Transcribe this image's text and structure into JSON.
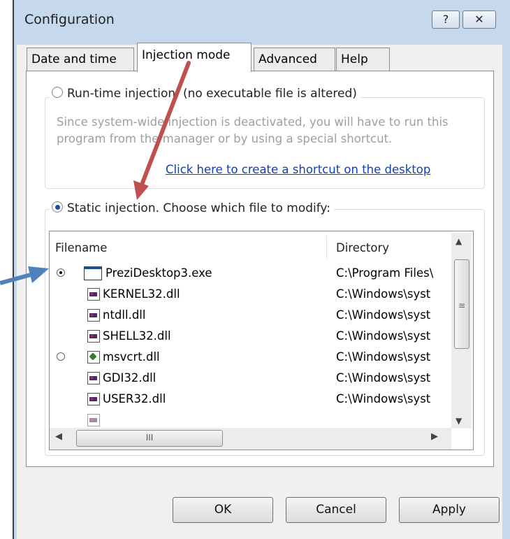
{
  "window": {
    "title": "Configuration",
    "help_icon": "?",
    "close_icon": "✕"
  },
  "tabs": [
    {
      "label": "Date and time",
      "active": false
    },
    {
      "label": "Injection mode",
      "active": true
    },
    {
      "label": "Advanced",
      "active": false
    },
    {
      "label": "Help",
      "active": false
    }
  ],
  "runtime": {
    "label": "Run-time injection. (no executable file is altered)",
    "selected": false,
    "description": "Since system-wide injection is deactivated, you will have to run this program from the manager or by using a special shortcut.",
    "link": "Click here to create a shortcut on the desktop"
  },
  "static": {
    "label": "Static injection. Choose which file to modify:",
    "selected": true
  },
  "list": {
    "columns": [
      "Filename",
      "Directory"
    ],
    "rows": [
      {
        "radio": "selected",
        "icon": "exe-icon",
        "name": "PreziDesktop3.exe",
        "dir": "C:\\Program Files\\"
      },
      {
        "radio": "none",
        "icon": "dll-icon",
        "name": "KERNEL32.dll",
        "dir": "C:\\Windows\\syst"
      },
      {
        "radio": "none",
        "icon": "dll-icon",
        "name": "ntdll.dll",
        "dir": "C:\\Windows\\syst"
      },
      {
        "radio": "none",
        "icon": "dll-icon",
        "name": "SHELL32.dll",
        "dir": "C:\\Windows\\syst"
      },
      {
        "radio": "empty",
        "icon": "dll-gear-icon",
        "name": "msvcrt.dll",
        "dir": "C:\\Windows\\syst"
      },
      {
        "radio": "none",
        "icon": "dll-icon",
        "name": "GDI32.dll",
        "dir": "C:\\Windows\\syst"
      },
      {
        "radio": "none",
        "icon": "dll-icon",
        "name": "USER32.dll",
        "dir": "C:\\Windows\\syst"
      }
    ],
    "hscroll_grip": "III",
    "vscroll_grip": "≡"
  },
  "buttons": {
    "ok": "OK",
    "cancel": "Cancel",
    "apply": "Apply"
  },
  "colors": {
    "annotation_arrow_red": "#c0504d",
    "annotation_arrow_blue": "#4f81bd",
    "link": "#0e3fb5"
  }
}
